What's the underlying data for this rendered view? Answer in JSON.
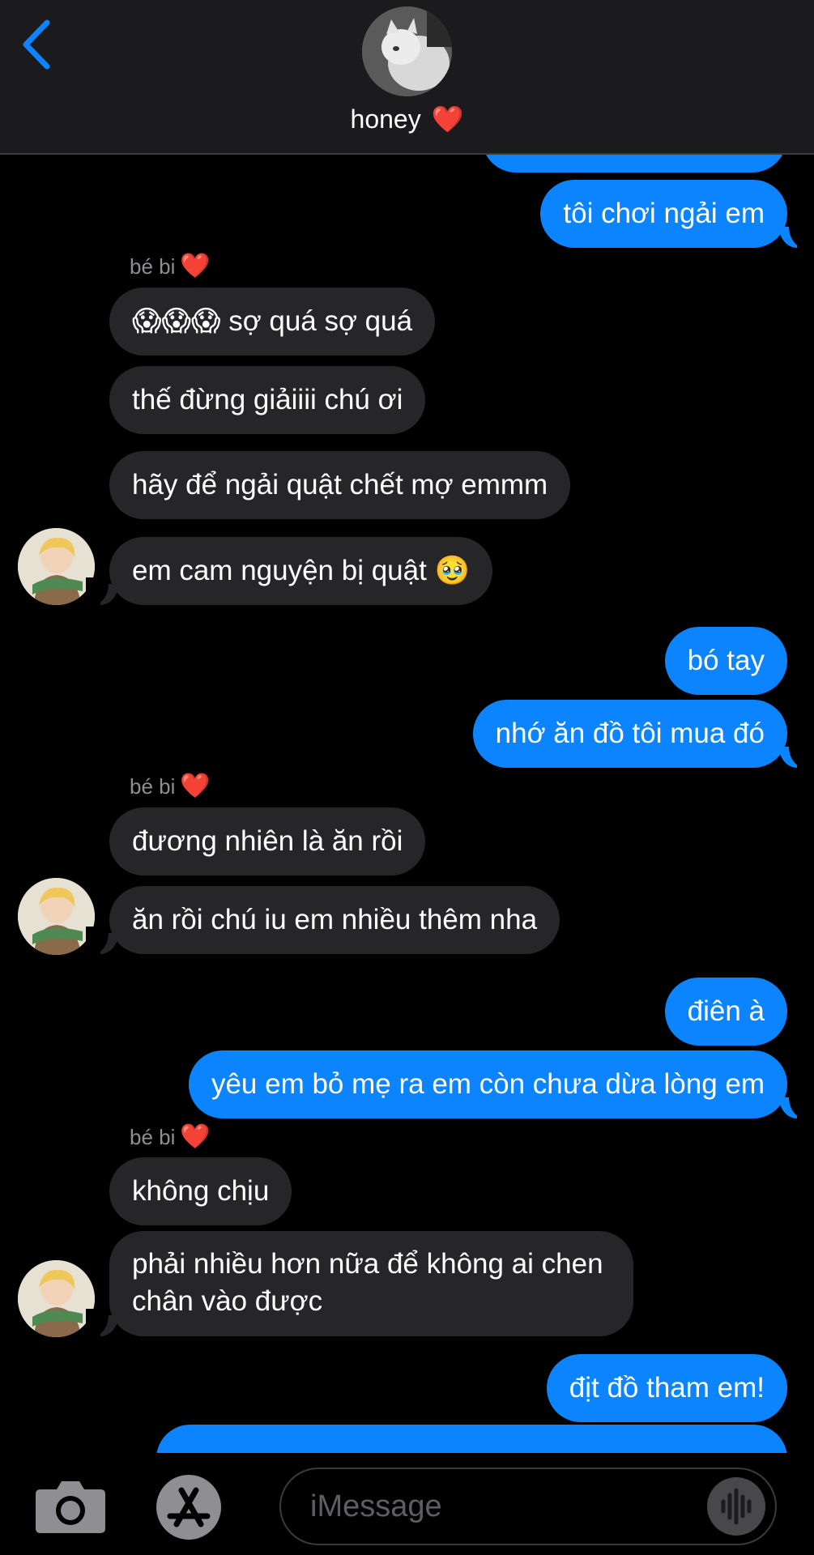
{
  "header": {
    "back_icon": "chevron-left-icon",
    "contact_name": "honey",
    "contact_emoji": "❤️"
  },
  "messages": [
    {
      "side": "sent",
      "text": "tôi chơi ngải em"
    },
    {
      "sender": "bé bi",
      "sender_emoji": "❤️"
    },
    {
      "side": "recv",
      "emoji": "😱😱😱",
      "text": "sợ quá sợ quá"
    },
    {
      "side": "recv",
      "text": "thế đừng giảiiii chú ơi"
    },
    {
      "side": "recv",
      "text": "hãy để ngải quật chết mợ emmm"
    },
    {
      "side": "recv",
      "text": "em cam nguyện bị quật",
      "emoji": "🥹"
    },
    {
      "side": "sent",
      "text": "bó tay"
    },
    {
      "side": "sent",
      "text": "nhớ ăn đồ tôi mua đó"
    },
    {
      "sender": "bé bi",
      "sender_emoji": "❤️"
    },
    {
      "side": "recv",
      "text": "đương nhiên là ăn rồi"
    },
    {
      "side": "recv",
      "text": "ăn rồi chú iu em nhiều thêm nha"
    },
    {
      "side": "sent",
      "text": "điên à"
    },
    {
      "side": "sent",
      "text": "yêu em bỏ mẹ ra em còn chưa dừa lòng em"
    },
    {
      "sender": "bé bi",
      "sender_emoji": "❤️"
    },
    {
      "side": "recv",
      "text": "không chịu"
    },
    {
      "side": "recv",
      "text": "phải nhiều hơn nữa để không ai chen chân vào được"
    },
    {
      "side": "sent",
      "text": "địt đồ tham em!"
    }
  ],
  "bottom_bar": {
    "camera_icon": "camera-icon",
    "apps_icon": "app-store-icon",
    "input_placeholder": "iMessage",
    "audio_icon": "audio-waveform-icon"
  },
  "colors": {
    "sent_bubble": "#0b84fe",
    "received_bubble": "#262628",
    "background": "#000000",
    "accent": "#0b84fe"
  }
}
